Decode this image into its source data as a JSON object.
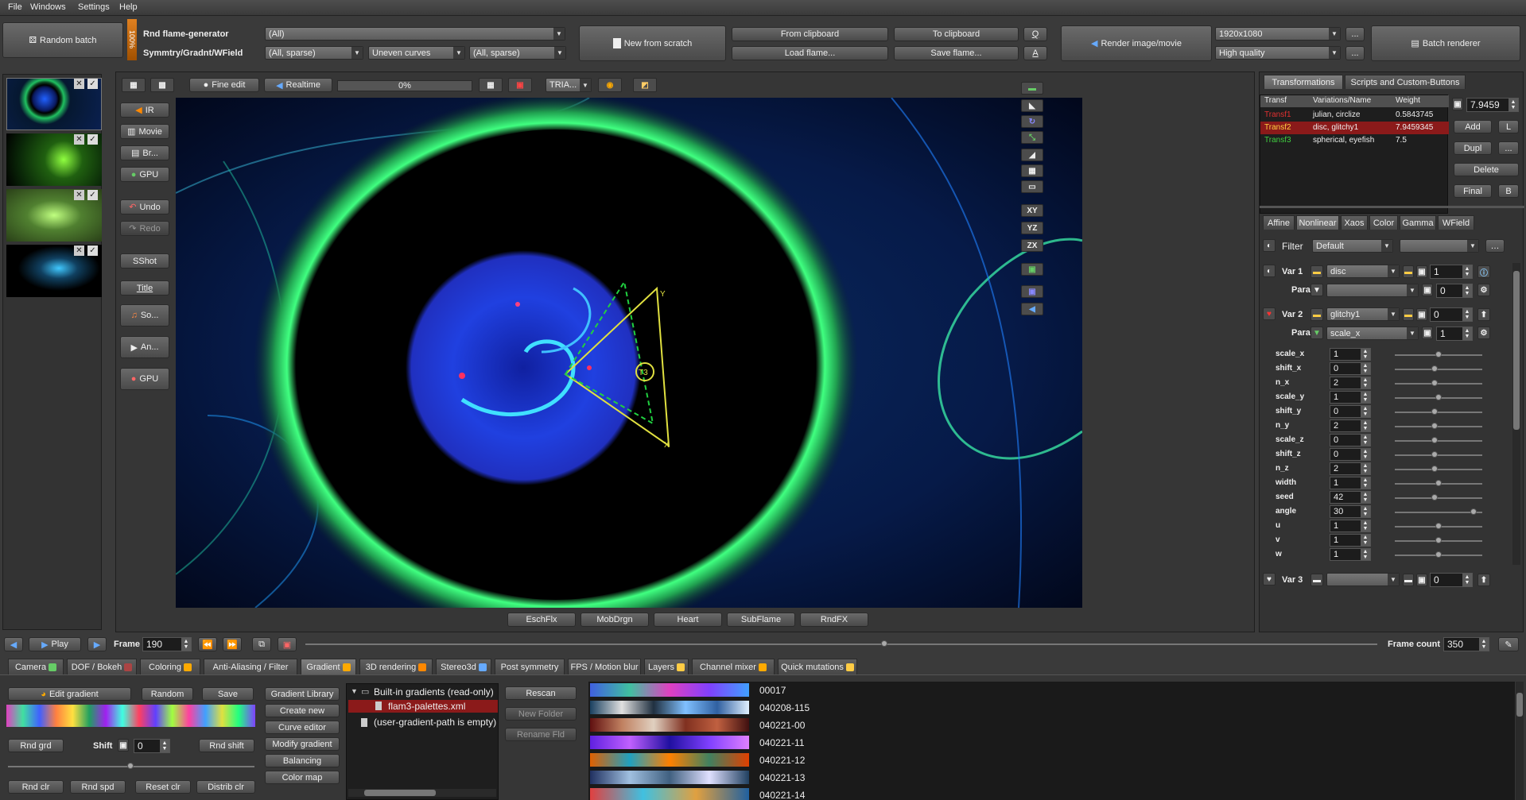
{
  "menu": [
    "File",
    "Windows",
    "Settings",
    "Help"
  ],
  "top": {
    "random_batch": "Random batch",
    "progress_pct": "100%",
    "rnd_flame_label": "Rnd flame-generator",
    "rnd_flame_value": "(All)",
    "symm_label": "Symmtry/Gradnt/WField",
    "symm_value": "(All, sparse)",
    "curves_value": "Uneven curves",
    "wfield_value": "(All, sparse)",
    "new_from_scratch": "New from scratch",
    "from_clipboard": "From clipboard",
    "to_clipboard": "To clipboard",
    "load_flame": "Load flame...",
    "save_flame": "Save flame...",
    "q_btn": "Q",
    "a_btn": "A",
    "render_image": "Render image/movie",
    "resolution": "1920x1080",
    "quality": "High quality",
    "more1": "...",
    "more2": "...",
    "batch_renderer": "Batch renderer"
  },
  "left_tools": [
    "IR",
    "Movie",
    "Br...",
    "GPU",
    "Undo",
    "Redo",
    "SShot",
    "Title",
    "So...",
    "An...",
    "GPU"
  ],
  "canvas_toolbar": {
    "fine_edit": "Fine edit",
    "realtime": "Realtime",
    "progress": "0%",
    "tria": "TRIA..."
  },
  "right_view": [
    "XY",
    "YZ",
    "ZX"
  ],
  "bottom_canvas_buttons": [
    "EschFlx",
    "MobDrgn",
    "Heart",
    "SubFlame",
    "RndFX"
  ],
  "triangle_labels": {
    "y": "Y",
    "x": "X",
    "t3": "T3"
  },
  "right_panel": {
    "tabs": [
      "Transformations",
      "Scripts and Custom-Buttons"
    ],
    "table_headers": [
      "Transf",
      "Variations/Name",
      "Weight"
    ],
    "rows": [
      {
        "name": "Transf1",
        "vars": "julian, circlize",
        "weight": "0.5843745",
        "color": "#e03030"
      },
      {
        "name": "Transf2",
        "vars": "disc, glitchy1",
        "weight": "7.9459345",
        "color": "#ffd040"
      },
      {
        "name": "Transf3",
        "vars": "spherical, eyefish",
        "weight": "7.5",
        "color": "#40d040"
      }
    ],
    "weight_value": "7.9459",
    "add": "Add",
    "l": "L",
    "dupl": "Dupl",
    "dots": "...",
    "delete": "Delete",
    "final": "Final",
    "b": "B",
    "sub_tabs": [
      "Affine",
      "Nonlinear",
      "Xaos",
      "Color",
      "Gamma",
      "WField"
    ],
    "filter_label": "Filter",
    "filter_value": "Default",
    "var1_label": "Var 1",
    "var1_value": "disc",
    "var1_amount": "1",
    "params_label": "Params",
    "params1_amount": "0",
    "var2_label": "Var 2",
    "var2_value": "glitchy1",
    "var2_amount": "0",
    "params2_value": "scale_x",
    "params2_amount": "1",
    "var3_label": "Var 3",
    "var3_amount": "0",
    "params": [
      {
        "name": "scale_x",
        "value": "1",
        "level": 0.5
      },
      {
        "name": "shift_x",
        "value": "0",
        "level": 0.45
      },
      {
        "name": "n_x",
        "value": "2",
        "level": 0.45
      },
      {
        "name": "scale_y",
        "value": "1",
        "level": 0.5
      },
      {
        "name": "shift_y",
        "value": "0",
        "level": 0.45
      },
      {
        "name": "n_y",
        "value": "2",
        "level": 0.45
      },
      {
        "name": "scale_z",
        "value": "0",
        "level": 0.45
      },
      {
        "name": "shift_z",
        "value": "0",
        "level": 0.45
      },
      {
        "name": "n_z",
        "value": "2",
        "level": 0.45
      },
      {
        "name": "width",
        "value": "1",
        "level": 0.5
      },
      {
        "name": "seed",
        "value": "42",
        "level": 0.45
      },
      {
        "name": "angle",
        "value": "30",
        "level": 0.9
      },
      {
        "name": "u",
        "value": "1",
        "level": 0.5
      },
      {
        "name": "v",
        "value": "1",
        "level": 0.5
      },
      {
        "name": "w",
        "value": "1",
        "level": 0.5
      }
    ]
  },
  "timeline": {
    "play": "Play",
    "frame_label": "Frame",
    "frame_value": "190",
    "frame_count_label": "Frame count",
    "frame_count_value": "350",
    "position": 0.54
  },
  "bottom_tabs": [
    "Camera",
    "DOF / Bokeh",
    "Coloring",
    "Anti-Aliasing / Filter",
    "Gradient",
    "3D rendering",
    "Stereo3d",
    "Post symmetry",
    "FPS / Motion blur",
    "Layers",
    "Channel mixer",
    "Quick mutations"
  ],
  "gradient": {
    "edit_gradient": "Edit gradient",
    "random": "Random",
    "save": "Save",
    "rnd_grd": "Rnd grd",
    "shift_label": "Shift",
    "shift_value": "0",
    "rnd_shift": "Rnd shift",
    "rnd_clr": "Rnd clr",
    "rnd_spd": "Rnd spd",
    "reset_clr": "Reset clr",
    "distrib_clr": "Distrib clr",
    "side": [
      "Gradient Library",
      "Create new",
      "Curve editor",
      "Modify gradient",
      "Balancing",
      "Color map"
    ],
    "tree_root": "Built-in gradients (read-only)",
    "tree_file": "flam3-palettes.xml",
    "tree_user": "(user-gradient-path is empty)",
    "rescan": "Rescan",
    "new_folder": "New Folder",
    "rename_fld": "Rename Fld",
    "palettes": [
      "00017",
      "040208-115",
      "040221-00",
      "040221-11",
      "040221-12",
      "040221-13",
      "040221-14"
    ]
  },
  "colors": {
    "accent": "#30c060",
    "selected_row": "#8b1a1a",
    "bg": "#3a3a3a"
  }
}
